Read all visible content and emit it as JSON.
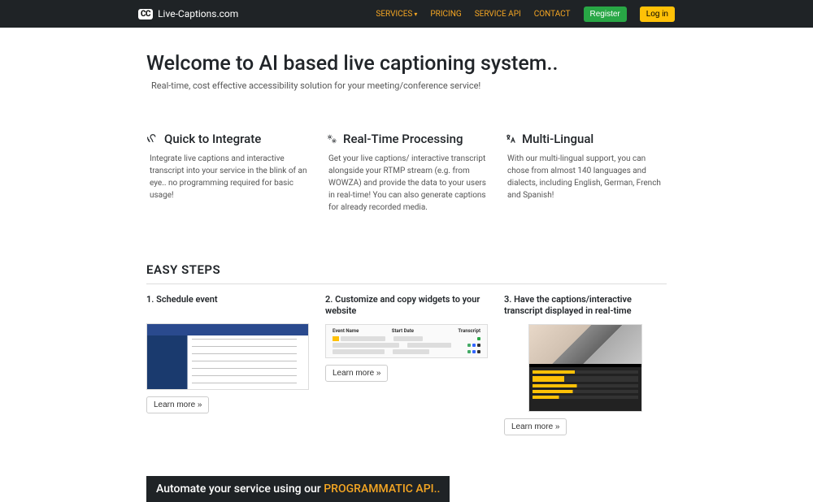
{
  "nav": {
    "brand": "Live-Captions.com",
    "links": {
      "services": "SERVICES",
      "pricing": "PRICING",
      "api": "SERVICE API",
      "contact": "CONTACT"
    },
    "register": "Register",
    "login": "Log in"
  },
  "hero": {
    "title": "Welcome to AI based live captioning system..",
    "subtitle": "Real-time, cost effective accessibility solution for your meeting/conference service!"
  },
  "features": [
    {
      "title": "Quick to Integrate",
      "desc": "Integrate live captions and interactive transcript into your service in the blink of an eye.. no programming required for basic usage!"
    },
    {
      "title": "Real-Time Processing",
      "desc": "Get your live captions/ interactive transcript alongside your RTMP stream (e.g. from WOWZA) and provide the data to your users in real-time! You can also generate captions for already recorded media."
    },
    {
      "title": "Multi-Lingual",
      "desc": "With our multi-lingual support, you can chose from almost 140 languages and dialects, including English, German, French and Spanish!"
    }
  ],
  "steps_heading": "EASY STEPS",
  "steps": [
    {
      "title": "1. Schedule event",
      "learn": "Learn more »"
    },
    {
      "title": "2. Customize and copy widgets to your website",
      "learn": "Learn more »"
    },
    {
      "title": "3. Have the captions/interactive transcript displayed in real-time",
      "learn": "Learn more »"
    }
  ],
  "img2": {
    "h1": "Event Name",
    "h2": "Start Date",
    "h3": "Transcript"
  },
  "cta": {
    "prefix": "Automate your service using our ",
    "link": "PROGRAMMATIC API.."
  }
}
